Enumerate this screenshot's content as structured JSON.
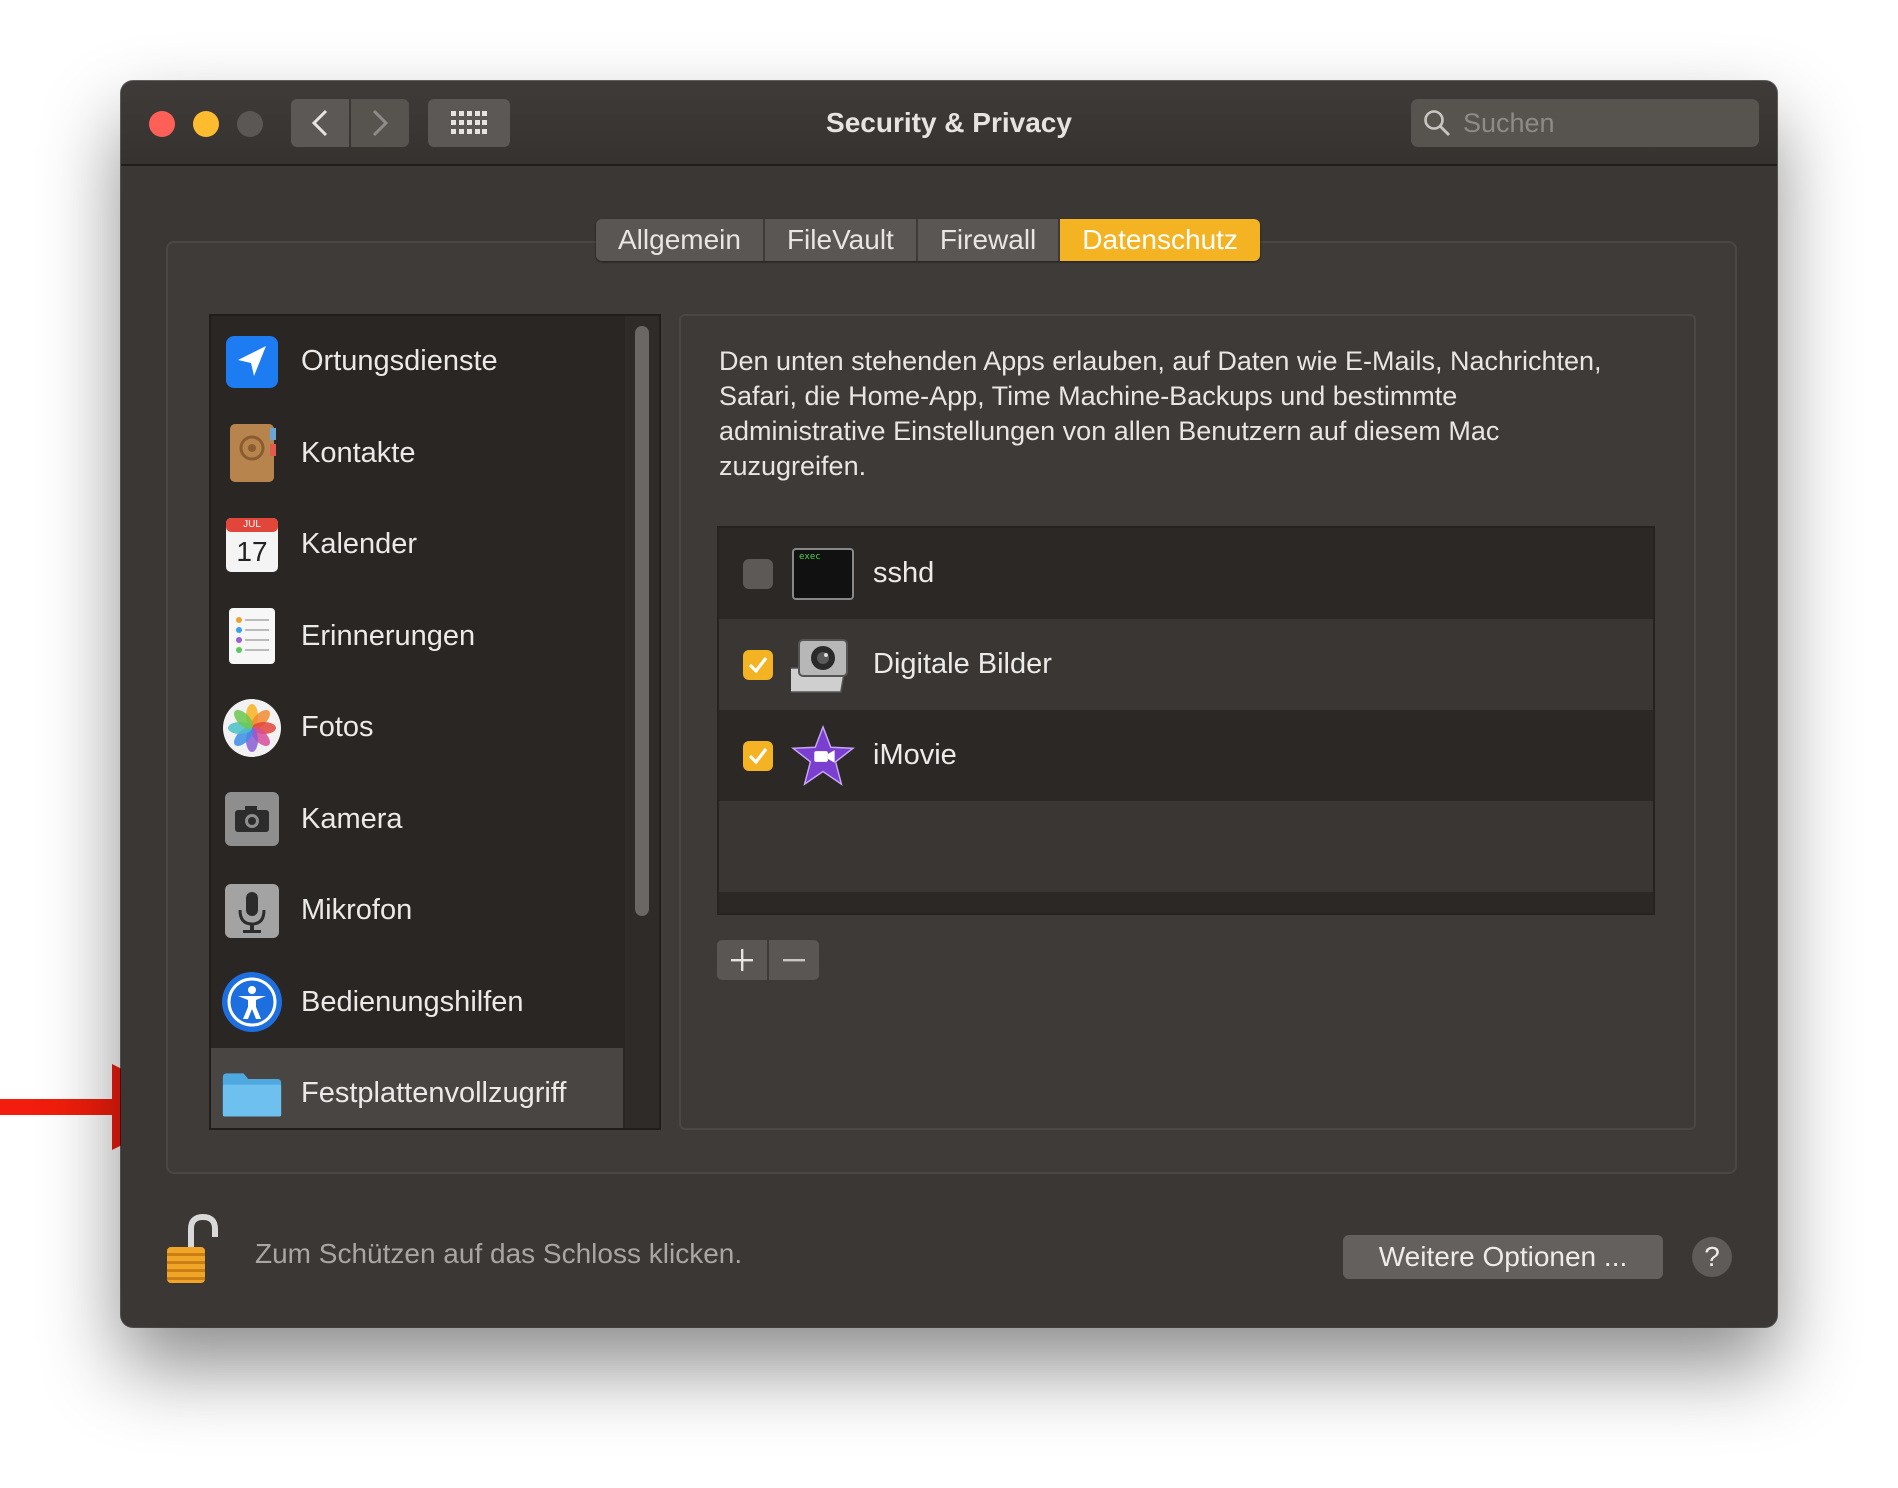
{
  "window": {
    "title": "Security & Privacy",
    "search_placeholder": "Suchen"
  },
  "tabs": [
    {
      "label": "Allgemein",
      "active": false
    },
    {
      "label": "FileVault",
      "active": false
    },
    {
      "label": "Firewall",
      "active": false
    },
    {
      "label": "Datenschutz",
      "active": true
    }
  ],
  "sidebar": {
    "items": [
      {
        "label": "Ortungsdienste",
        "icon": "location-arrow-icon"
      },
      {
        "label": "Kontakte",
        "icon": "contacts-book-icon"
      },
      {
        "label": "Kalender",
        "icon": "calendar-icon",
        "calendar_month": "JUL",
        "calendar_day": "17"
      },
      {
        "label": "Erinnerungen",
        "icon": "reminders-list-icon"
      },
      {
        "label": "Fotos",
        "icon": "photos-flower-icon"
      },
      {
        "label": "Kamera",
        "icon": "camera-icon"
      },
      {
        "label": "Mikrofon",
        "icon": "microphone-icon"
      },
      {
        "label": "Bedienungshilfen",
        "icon": "accessibility-icon"
      },
      {
        "label": "Festplattenvollzugriff",
        "icon": "folder-icon",
        "selected": true
      }
    ]
  },
  "content": {
    "description": "Den unten stehenden Apps erlauben, auf Daten wie E-Mails, Nachrichten, Safari, die Home-App, Time Machine-Backups und bestimmte administrative Einstellungen von allen Benutzern auf diesem Mac zuzugreifen.",
    "apps": [
      {
        "name": "sshd",
        "checked": false,
        "icon": "terminal-exec-icon",
        "icon_text": "exec"
      },
      {
        "name": "Digitale Bilder",
        "checked": true,
        "icon": "image-capture-icon"
      },
      {
        "name": "iMovie",
        "checked": true,
        "icon": "imovie-star-icon"
      }
    ]
  },
  "footer": {
    "lock_text": "Zum Schützen auf das Schloss klicken.",
    "more_options_label": "Weitere Optionen ...",
    "help_label": "?"
  },
  "colors": {
    "accent": "#f4b323",
    "annotation_arrow": "#f21d0c",
    "window_bg": "#3b3735"
  }
}
